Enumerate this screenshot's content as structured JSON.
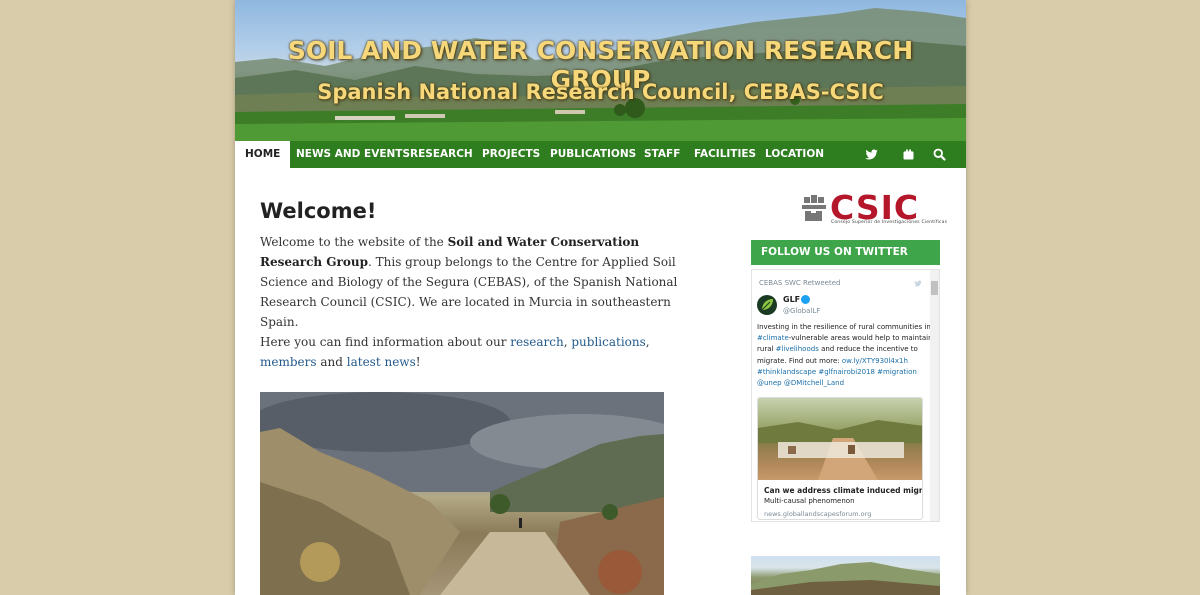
{
  "header": {
    "title": "SOIL AND WATER CONSERVATION RESEARCH GROUP",
    "subtitle": "Spanish National Research Council, CEBAS-CSIC"
  },
  "nav": {
    "items": [
      {
        "label": "HOME",
        "active": true
      },
      {
        "label": "NEWS AND EVENTS",
        "active": false
      },
      {
        "label": "RESEARCH",
        "active": false
      },
      {
        "label": "PROJECTS",
        "active": false
      },
      {
        "label": "PUBLICATIONS",
        "active": false
      },
      {
        "label": "STAFF",
        "active": false
      },
      {
        "label": "FACILITIES",
        "active": false
      },
      {
        "label": "LOCATION",
        "active": false
      }
    ],
    "icons": [
      "twitter-icon",
      "flickr-icon",
      "search-icon"
    ]
  },
  "main": {
    "heading": "Welcome!",
    "para1": {
      "t1": "Welcome to the website of the ",
      "bold": "Soil and Water Conservation Research Group",
      "t2": ". This group belongs to the Centre for Applied Soil Science and Biology of the Segura (CEBAS), of the Spanish National Research Council (CSIC). We are located in Murcia in southeastern Spain."
    },
    "para2": {
      "t1": "Here you can find information about our ",
      "link_research": "research",
      "sep1": ", ",
      "link_publications": "publications",
      "sep2": ", ",
      "link_members": "members",
      "t2": " and ",
      "link_news": "latest news",
      "t3": "!"
    }
  },
  "sidebar": {
    "logo_text": "CSIC",
    "logo_subtext": "Consejo Superior de Investigaciones Científicas",
    "twitter_heading": "FOLLOW US ON TWITTER",
    "tweet": {
      "retweet_label": "CEBAS SWC Retweeted",
      "author_name": "GLF",
      "author_handle": "@GlobalLF",
      "lines": [
        {
          "parts": [
            {
              "t": "Investing in the resilience of rural communities in",
              "hl": false
            }
          ]
        },
        {
          "parts": [
            {
              "t": "#climate",
              "hl": true
            },
            {
              "t": "-vulnerable areas would help to maintain",
              "hl": false
            }
          ]
        },
        {
          "parts": [
            {
              "t": "rural ",
              "hl": false
            },
            {
              "t": "#livelihoods",
              "hl": true
            },
            {
              "t": " and reduce the incentive to",
              "hl": false
            }
          ]
        },
        {
          "parts": [
            {
              "t": "migrate. Find out more: ",
              "hl": false
            },
            {
              "t": "ow.ly/XTY930l4x1h",
              "hl": true
            }
          ]
        },
        {
          "parts": [
            {
              "t": "#thinklandscape #glfnairobi2018 #migration",
              "hl": true
            }
          ]
        },
        {
          "parts": [
            {
              "t": "@unep @DMitchell_Land",
              "hl": true
            }
          ]
        }
      ],
      "card_title": "Can we address climate induced migra...",
      "card_subtitle": "Multi-causal phenomenon",
      "card_url": "news.globallandscapesforum.org"
    }
  },
  "colors": {
    "nav_bg": "#2e7d1f",
    "twitter_bar": "#3fa54a",
    "title_gold": "#f6d77a",
    "csic_red": "#b5172a",
    "link": "#245a8c",
    "page_bg": "#d8ccaa"
  }
}
